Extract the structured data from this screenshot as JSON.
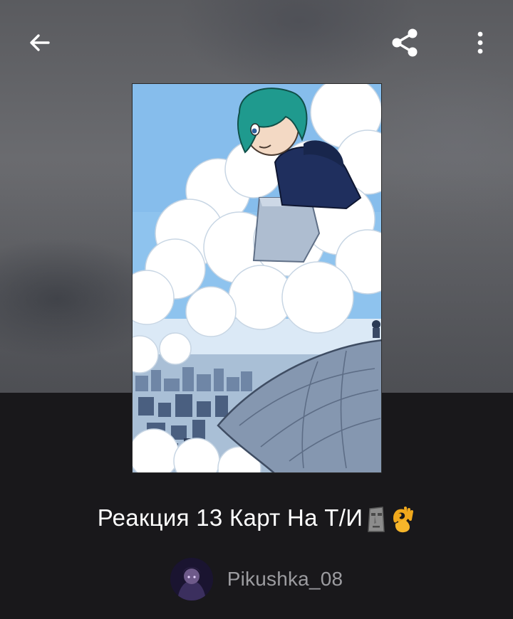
{
  "toolbar": {
    "back_icon": "arrow-left-icon",
    "share_icon": "share-icon",
    "more_icon": "more-vertical-icon"
  },
  "story": {
    "cover_description": "comic-cover-image",
    "title": "Реакция 13 Карт На Т/И",
    "title_emojis": [
      "moai-emoji",
      "ok-hand-emoji"
    ]
  },
  "author": {
    "name": "Pikushka_08",
    "avatar_icon": "avatar-image"
  },
  "colors": {
    "background_dark": "#19181b",
    "backdrop_gray": "#616266",
    "title_text": "#ffffff",
    "author_text": "#9c9ca0",
    "sky_blue": "#8ec3ee"
  }
}
